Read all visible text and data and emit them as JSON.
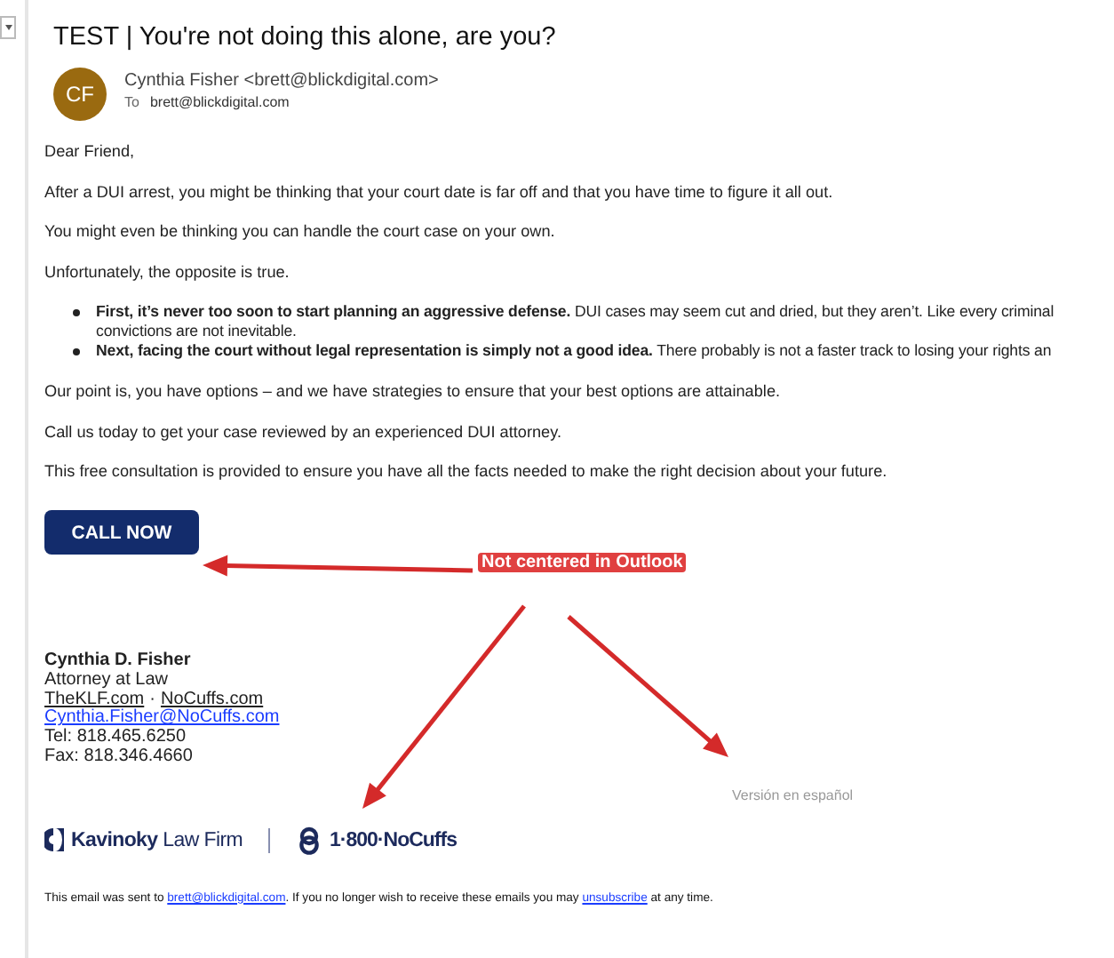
{
  "header": {
    "subject": "TEST | You're not doing this alone, are you?",
    "avatar_initials": "CF",
    "sender": "Cynthia Fisher <brett@blickdigital.com>",
    "to_label": "To",
    "to": "brett@blickdigital.com"
  },
  "blocks": [
    {
      "kind": "paragraph",
      "text": "Dear Friend,"
    },
    {
      "kind": "paragraph",
      "text": "After a DUI arrest, you might be thinking that your court date is far off and that you have time to figure it all out."
    },
    {
      "kind": "paragraph",
      "text": "You might even be thinking you can handle the court case on your own."
    },
    {
      "kind": "paragraph",
      "text": "Unfortunately, the opposite is true."
    },
    {
      "kind": "bullets",
      "items": [
        {
          "lines": [
            "**First, it’s never too soon to start planning an aggressive defense.** DUI cases may seem cut and dried, but they aren’t. Like every criminal",
            "convictions are not inevitable."
          ]
        },
        {
          "lines": [
            "**Next, facing the court without legal representation is simply not a good idea.** There probably is not a faster track to losing your rights an"
          ]
        }
      ]
    },
    {
      "kind": "paragraph",
      "text": "Our point is, you have options – and we have strategies to ensure that your best options are attainable."
    },
    {
      "kind": "paragraph",
      "text": "Call us today to get your case reviewed by an experienced DUI attorney."
    },
    {
      "kind": "paragraph",
      "text": "This free consultation is provided to ensure you have all the facts needed to make the right decision about your future."
    }
  ],
  "cta_button": "CALL NOW",
  "signature": {
    "name": "Cynthia D. Fisher",
    "title": "Attorney at Law",
    "sites": [
      "TheKLF.com",
      "NoCuffs.com"
    ],
    "separator": "·",
    "email": "Cynthia.Fisher@NoCuffs.com",
    "tel": "Tel: 818.465.6250",
    "fax": "Fax: 818.346.4660"
  },
  "spanish_link": "Versión en español",
  "logos": {
    "firm": "**Kavinoky** Law Firm",
    "phone": "1·800·NoCuffs"
  },
  "footer": {
    "before": "This email was sent to ",
    "email": "brett@blickdigital.com",
    "middle": ". If you no longer wish to receive these emails you may ",
    "unsubscribe": "unsubscribe",
    "after": " at any time."
  },
  "annotation": {
    "label": "Not centered in Outlook"
  }
}
